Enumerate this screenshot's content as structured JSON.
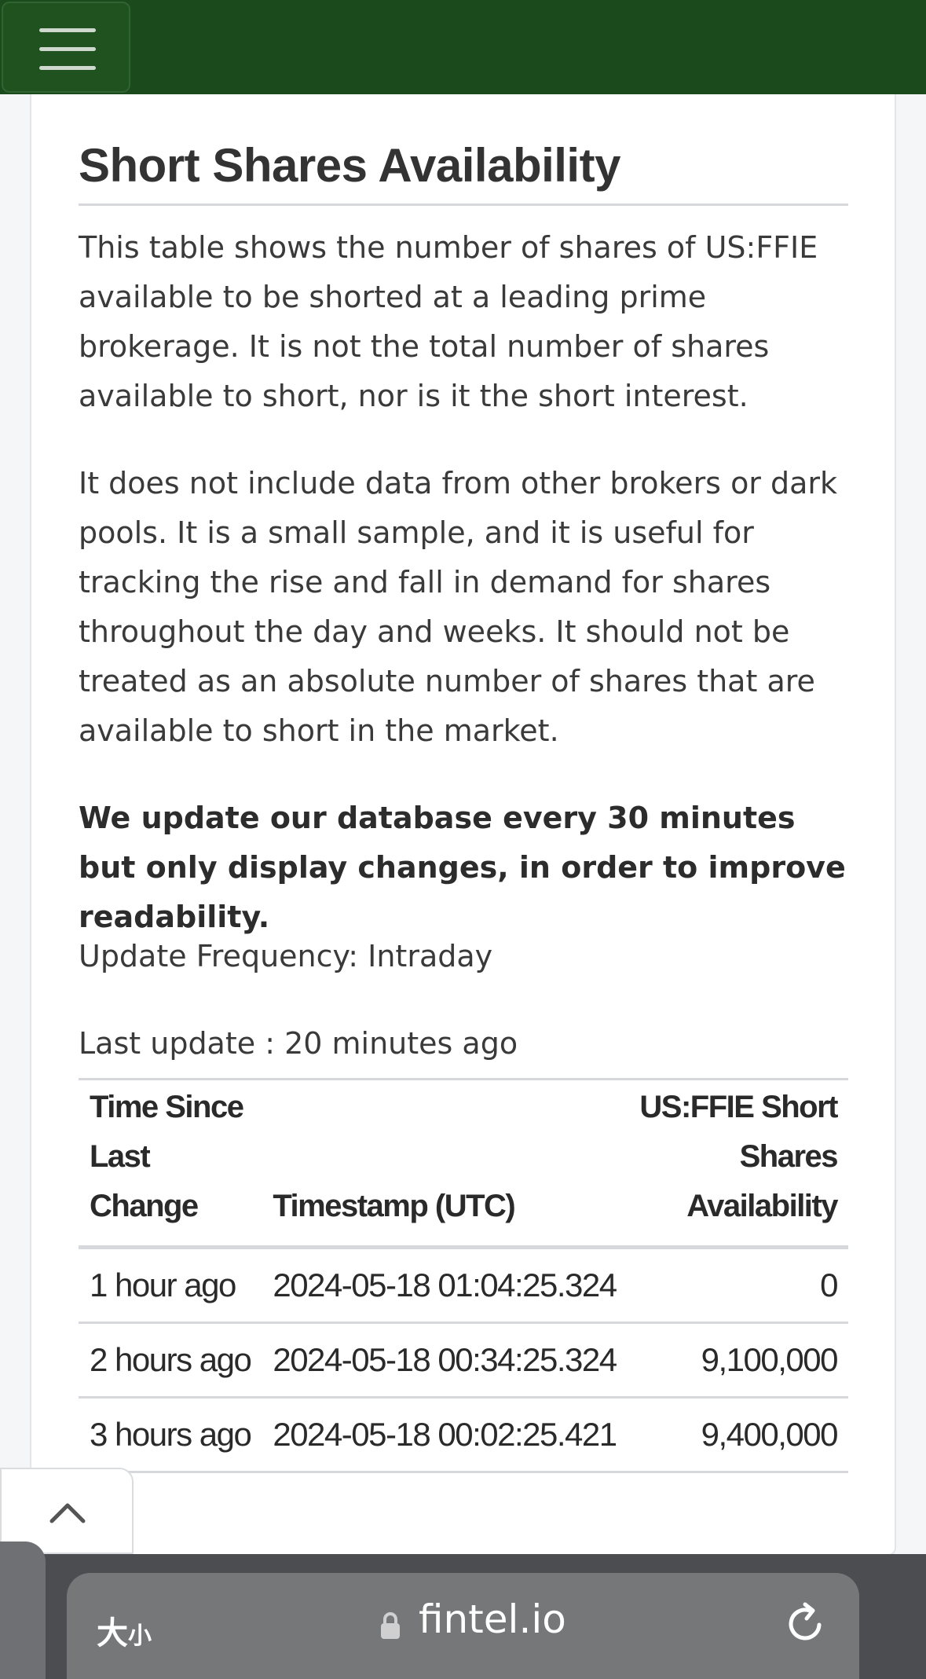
{
  "header": {
    "menu_label": ""
  },
  "section": {
    "title": "Short Shares Availability",
    "paragraph1": "This table shows the number of shares of US:FFIE available to be shorted at a leading prime brokerage. It is not the total number of shares available to short, nor is it the short interest.",
    "paragraph2": "It does not include data from other brokers or dark pools. It is a small sample, and it is useful for tracking the rise and fall in demand for shares throughout the day and weeks. It should not be treated as an absolute number of shares that are available to short in the market.",
    "notice": "We update our database every 30 minutes but only display changes, in order to improve readability.",
    "update_frequency": "Update Frequency: Intraday",
    "last_update": "Last update : 20 minutes ago"
  },
  "table": {
    "headers": {
      "time_since": "Time Since Last Change",
      "timestamp": "Timestamp (UTC)",
      "availability": "US:FFIE Short Shares Availability"
    },
    "rows": [
      {
        "time_since": "1 hour ago",
        "timestamp": "2024-05-18 01:04:25.324",
        "availability": "0"
      },
      {
        "time_since": "2 hours ago",
        "timestamp": "2024-05-18 00:34:25.324",
        "availability": "9,100,000"
      },
      {
        "time_since": "3 hours ago",
        "timestamp": "2024-05-18 00:02:25.421",
        "availability": "9,400,000"
      }
    ]
  },
  "browser": {
    "text_size_label": "大",
    "text_size_label_small": "小",
    "domain": "fintel.io"
  },
  "icons": {
    "menu": "hamburger-icon",
    "scroll_top": "chevron-up-icon",
    "lock": "lock-icon",
    "reload": "reload-icon"
  },
  "colors": {
    "topbar": "#1b4a1c",
    "browser_bar": "#4b4d50"
  }
}
